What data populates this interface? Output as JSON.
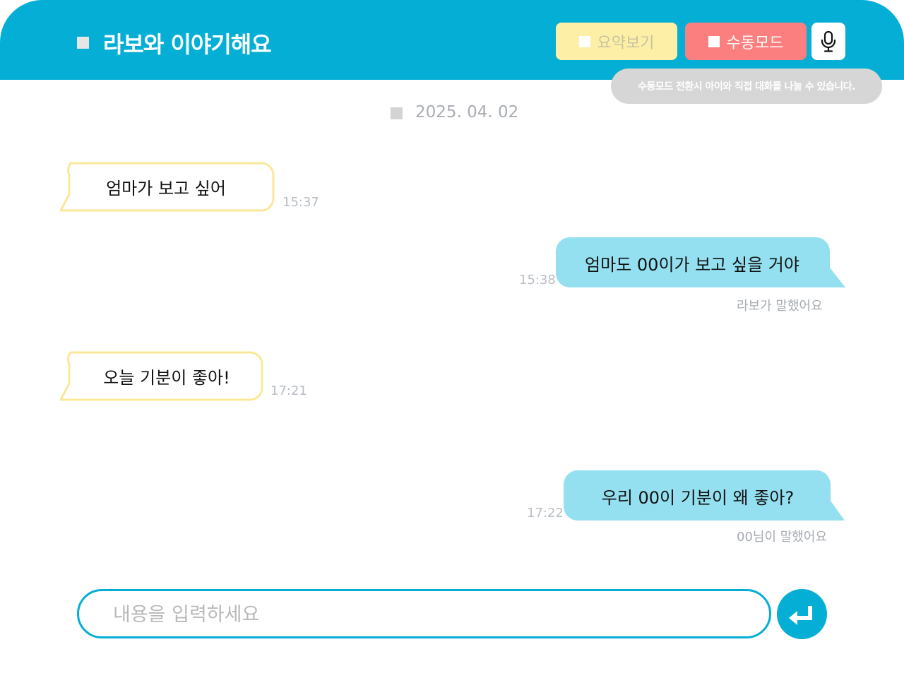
{
  "header": {
    "title": "라보와 이야기해요",
    "summary_button": "요약보기",
    "manual_button": "수동모드",
    "mic_icon": "microphone-icon",
    "tooltip": "수동모드 전환시 아이와 직접 대화를 나눌 수 있습니다."
  },
  "date": "2025. 04. 02",
  "messages": [
    {
      "side": "left",
      "text": "엄마가 보고 싶어",
      "time": "15:37",
      "speaker": ""
    },
    {
      "side": "right",
      "text": "엄마도 00이가 보고 싶을 거야",
      "time": "15:38",
      "speaker": "라보가 말했어요"
    },
    {
      "side": "left",
      "text": "오늘 기분이 좋아!",
      "time": "17:21",
      "speaker": ""
    },
    {
      "side": "right",
      "text": "우리 00이 기분이 왜 좋아?",
      "time": "17:22",
      "speaker": "00님이 말했어요"
    }
  ],
  "input": {
    "placeholder": "내용을 입력하세요",
    "value": "",
    "send_icon": "enter-icon"
  },
  "colors": {
    "brand": "#05aed4",
    "summary_bg": "#fdf0a6",
    "manual_bg": "#fc7f7f",
    "child_bubble_border": "#fae89a",
    "robot_bubble_bg": "#94e0f0",
    "tooltip_bg": "#d6d6d6"
  }
}
